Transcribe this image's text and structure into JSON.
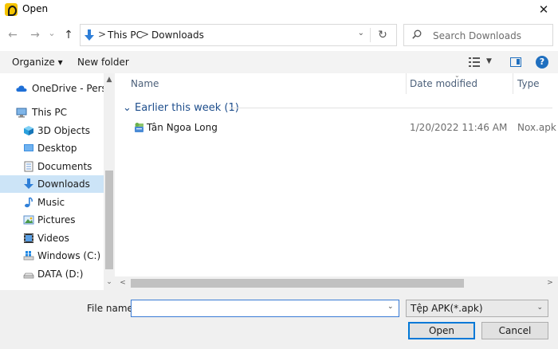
{
  "window": {
    "title": "Open",
    "close_glyph": "✕"
  },
  "nav": {
    "back_glyph": "←",
    "forward_glyph": "→",
    "recent_glyph": "⌄",
    "up_glyph": "↑",
    "breadcrumbs": [
      "This PC",
      "Downloads"
    ],
    "separator": ">",
    "refresh_glyph": "↻",
    "dropdown_glyph": "⌄"
  },
  "search": {
    "placeholder": "Search Downloads"
  },
  "toolbar": {
    "organize_label": "Organize ▾",
    "new_folder_label": "New folder",
    "view_caret": "▼",
    "help_glyph": "?"
  },
  "sidebar": {
    "items": [
      {
        "label": "OneDrive - Person",
        "icon": "cloud-icon"
      },
      {
        "label": "This PC",
        "icon": "computer-icon"
      },
      {
        "label": "3D Objects",
        "icon": "cube-icon"
      },
      {
        "label": "Desktop",
        "icon": "desktop-icon"
      },
      {
        "label": "Documents",
        "icon": "document-icon"
      },
      {
        "label": "Downloads",
        "icon": "download-icon",
        "selected": true
      },
      {
        "label": "Music",
        "icon": "music-icon"
      },
      {
        "label": "Pictures",
        "icon": "pictures-icon"
      },
      {
        "label": "Videos",
        "icon": "videos-icon"
      },
      {
        "label": "Windows (C:)",
        "icon": "windows-drive-icon"
      },
      {
        "label": "DATA (D:)",
        "icon": "drive-icon"
      }
    ],
    "scroll_up_glyph": "▲",
    "scroll_down_glyph": "⌄"
  },
  "columns": {
    "name": "Name",
    "date": "Date modified",
    "type": "Type",
    "sort_glyph": "⌄"
  },
  "groups": [
    {
      "title": "Earlier this week (1)",
      "chevron": "⌄",
      "files": [
        {
          "name": "Tân Ngoa Long",
          "date": "1/20/2022 11:46 AM",
          "type": "Nox.apk",
          "icon": "apk-file-icon"
        }
      ]
    }
  ],
  "hscroll": {
    "left_glyph": "<",
    "right_glyph": ">"
  },
  "bottom": {
    "file_name_label": "File name:",
    "file_name_value": "",
    "file_name_caret": "⌄",
    "file_type_value": "Tệp APK(*.apk)",
    "file_type_caret": "⌄",
    "open_label": "Open",
    "cancel_label": "Cancel"
  },
  "colors": {
    "accent": "#0078d7",
    "selected_bg": "#cce4f7",
    "group_heading": "#1e4e8c",
    "column_heading": "#4c607a",
    "folder_blue": "#2f7fd8"
  }
}
